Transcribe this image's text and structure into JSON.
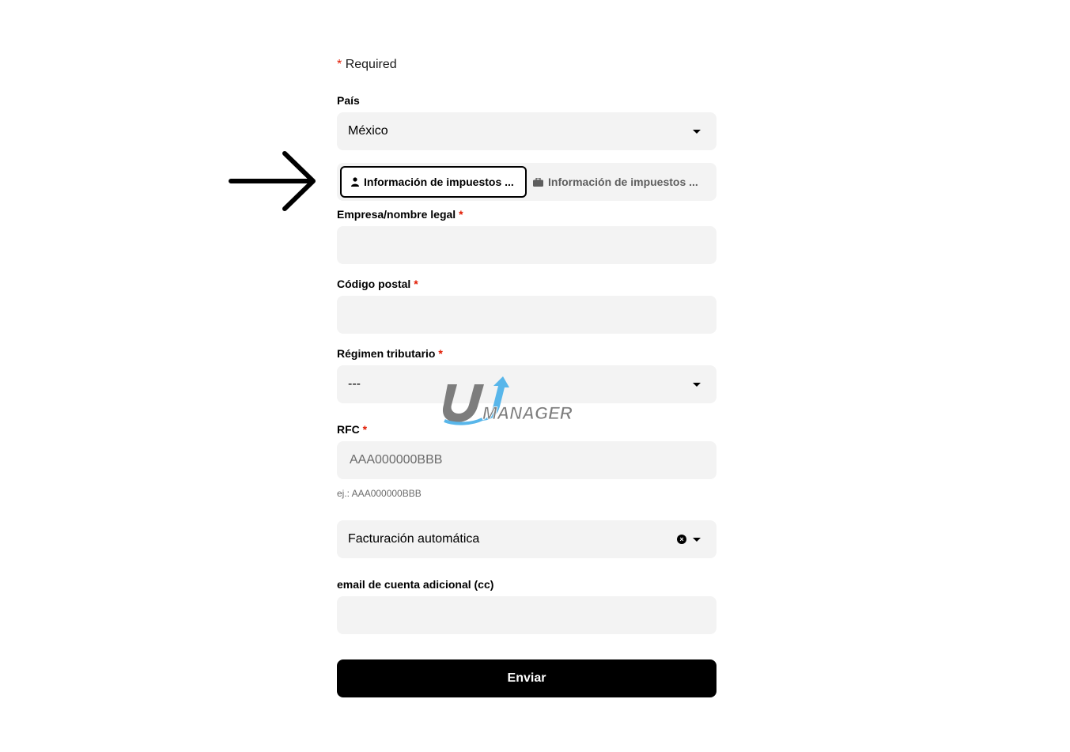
{
  "required_note": {
    "star": "*",
    "text": "Required"
  },
  "pais": {
    "label": "País",
    "value": "México",
    "icon": "chevron-down-icon"
  },
  "tax_tabs": [
    {
      "label": "Información de impuestos ...",
      "icon": "person-icon",
      "selected": true
    },
    {
      "label": "Información de impuestos ...",
      "icon": "briefcase-icon",
      "selected": false
    }
  ],
  "empresa": {
    "label": "Empresa/nombre legal",
    "star": "*",
    "value": ""
  },
  "codigo_postal": {
    "label": "Código postal",
    "star": "*",
    "value": ""
  },
  "regimen": {
    "label": "Régimen tributario",
    "star": "*",
    "value": "---"
  },
  "rfc": {
    "label": "RFC",
    "star": "*",
    "placeholder": "AAA000000BBB",
    "hint": "ej.: AAA000000BBB"
  },
  "facturacion": {
    "value": "Facturación automática",
    "clear_icon": "clear-icon"
  },
  "email_cc": {
    "label": "email de cuenta adicional (cc)",
    "value": ""
  },
  "submit": {
    "label": "Enviar"
  },
  "annotation": {
    "icon": "arrow-right-icon"
  },
  "watermark": {
    "text": "MANAGER",
    "logo": "u-manager-logo"
  },
  "colors": {
    "required_star": "#e11900",
    "field_bg": "#f3f3f3",
    "button_bg": "#000000",
    "watermark_blue": "#58b6ea",
    "watermark_gray": "#7d7d7d"
  }
}
